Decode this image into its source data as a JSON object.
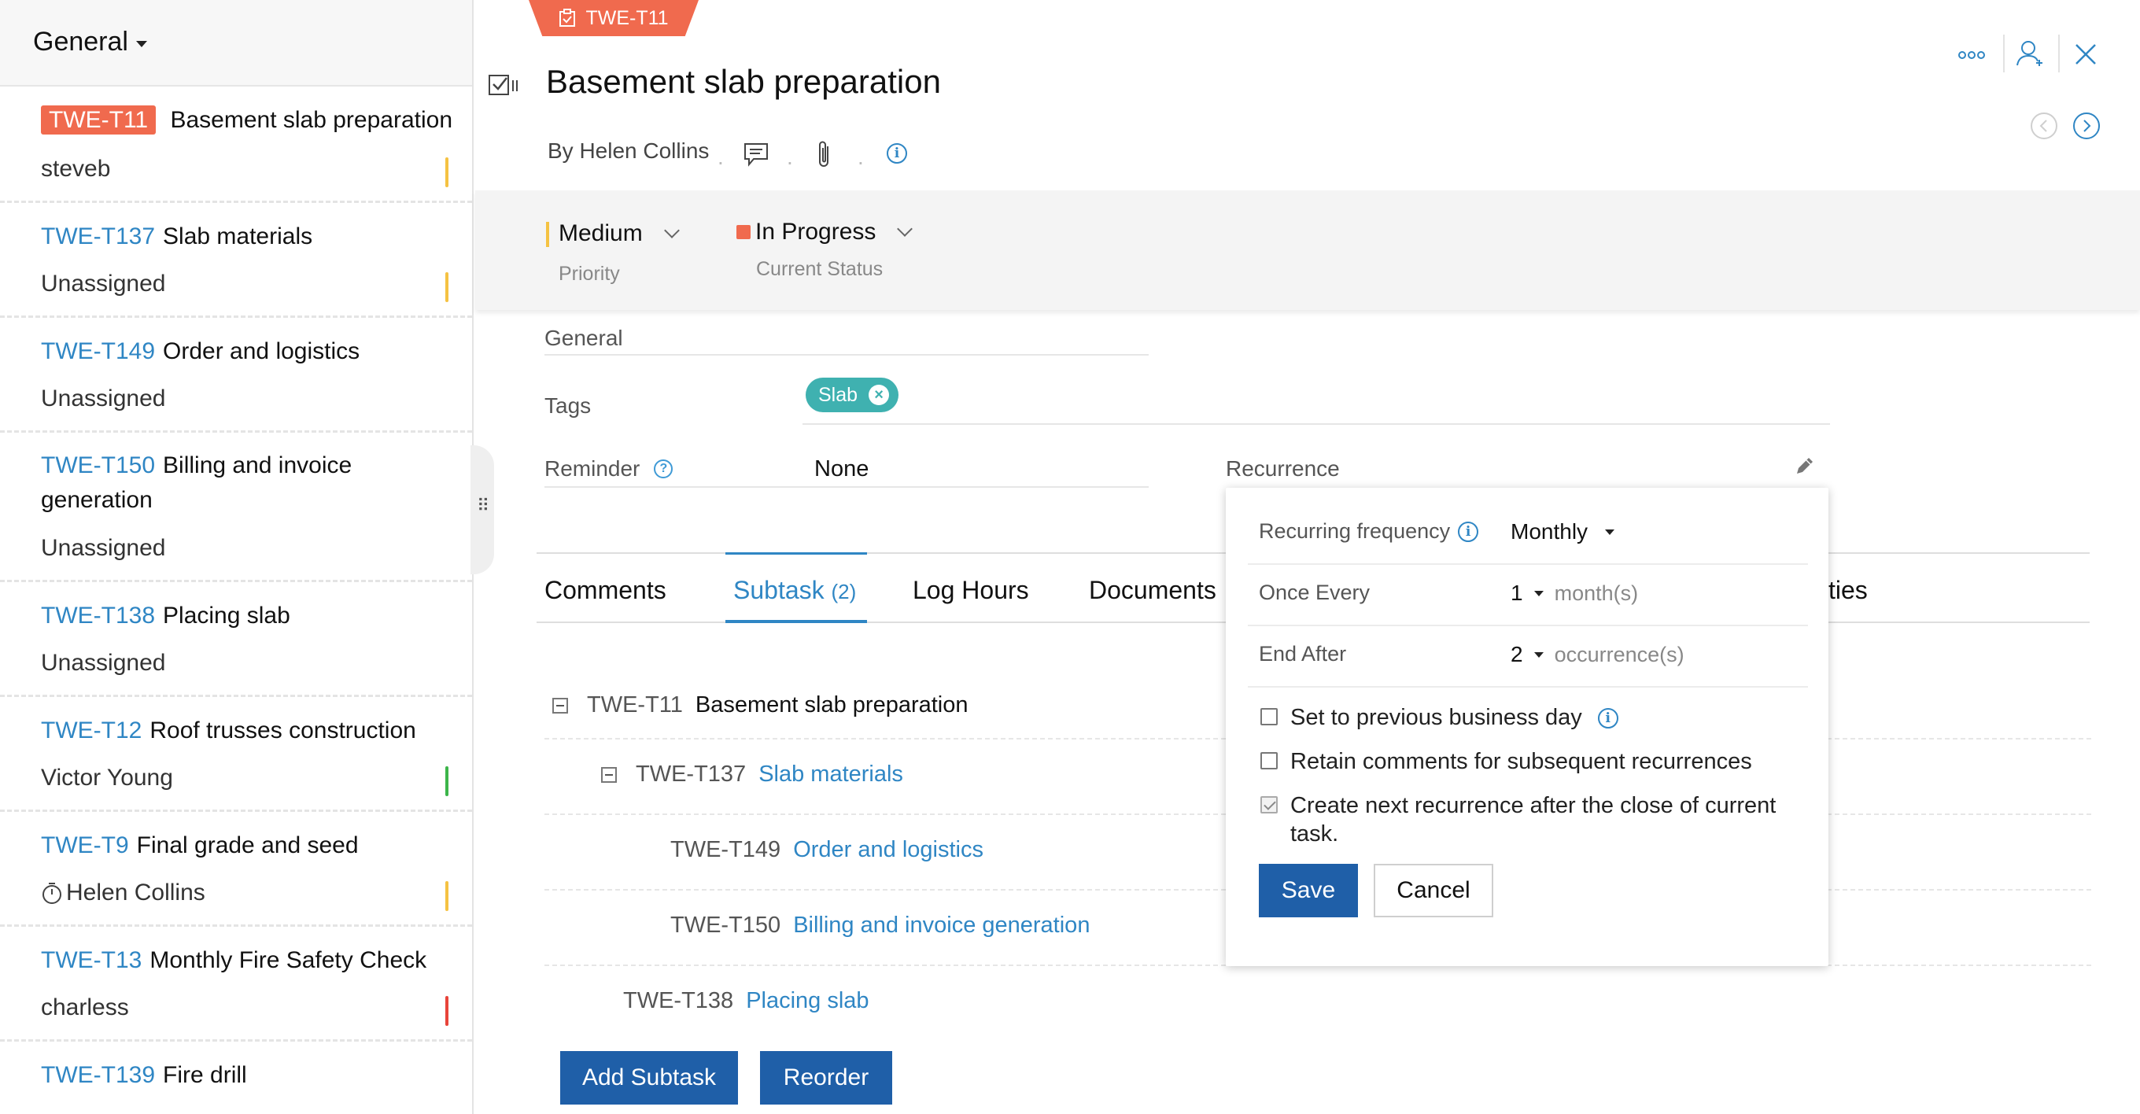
{
  "sidebar": {
    "title": "General",
    "items": [
      {
        "id": "TWE-T11",
        "name": "Basement slab preparation",
        "assignee": "steveb",
        "priority_color": "#f5c242",
        "active": true
      },
      {
        "id": "TWE-T137",
        "name": "Slab materials",
        "assignee": "Unassigned",
        "priority_color": "#f5c242"
      },
      {
        "id": "TWE-T149",
        "name": "Order and logistics",
        "assignee": "Unassigned",
        "priority_color": ""
      },
      {
        "id": "TWE-T150",
        "name": "Billing and invoice generation",
        "assignee": "Unassigned",
        "priority_color": ""
      },
      {
        "id": "TWE-T138",
        "name": "Placing slab",
        "assignee": "Unassigned",
        "priority_color": ""
      },
      {
        "id": "TWE-T12",
        "name": "Roof trusses construction",
        "assignee": "Victor Young",
        "priority_color": "#3cb54a"
      },
      {
        "id": "TWE-T9",
        "name": "Final grade and seed",
        "assignee": "Helen Collins",
        "priority_color": "#f5c242"
      },
      {
        "id": "TWE-T13",
        "name": "Monthly Fire Safety Check",
        "assignee": "charless",
        "priority_color": "#e8443a"
      },
      {
        "id": "TWE-T139",
        "name": "Fire drill",
        "assignee": "",
        "priority_color": ""
      }
    ]
  },
  "task": {
    "tab_id": "TWE-T11",
    "title": "Basement slab preparation",
    "byline": "By Helen Collins",
    "priority": {
      "value": "Medium",
      "label": "Priority",
      "color": "#f5c242"
    },
    "status": {
      "value": "In Progress",
      "label": "Current Status",
      "color": "#f06a4e"
    },
    "tasklist_value": "General",
    "tags_label": "Tags",
    "tag": "Slab",
    "reminder_label": "Reminder",
    "reminder_value": "None",
    "recurrence_label": "Recurrence"
  },
  "tabs": {
    "comments": "Comments",
    "subtask": "Subtask",
    "subtask_count": "(2)",
    "log_hours": "Log Hours",
    "documents": "Documents",
    "activities_partial": "ties"
  },
  "subtasks": [
    {
      "id": "TWE-T11",
      "name": "Basement slab preparation"
    },
    {
      "id": "TWE-T137",
      "name": "Slab materials"
    },
    {
      "id": "TWE-T149",
      "name": "Order and logistics"
    },
    {
      "id": "TWE-T150",
      "name": "Billing and invoice generation"
    },
    {
      "id": "TWE-T138",
      "name": "Placing slab"
    }
  ],
  "buttons": {
    "add_subtask": "Add Subtask",
    "reorder": "Reorder"
  },
  "recurrence": {
    "frequency_label": "Recurring frequency",
    "frequency_value": "Monthly",
    "once_every_label": "Once Every",
    "once_every_value": "1",
    "once_every_unit": "month(s)",
    "end_after_label": "End After",
    "end_after_value": "2",
    "end_after_unit": "occurrence(s)",
    "opt_prev_business_day": "Set to previous business day",
    "opt_retain_comments": "Retain comments for subsequent recurrences",
    "opt_next_after_close": "Create next recurrence after the close of current task.",
    "save": "Save",
    "cancel": "Cancel"
  },
  "icons": {
    "more": "more-options-icon",
    "assign": "assign-user-icon",
    "close": "close-icon",
    "prev": "prev-task-icon",
    "next": "next-task-icon"
  }
}
